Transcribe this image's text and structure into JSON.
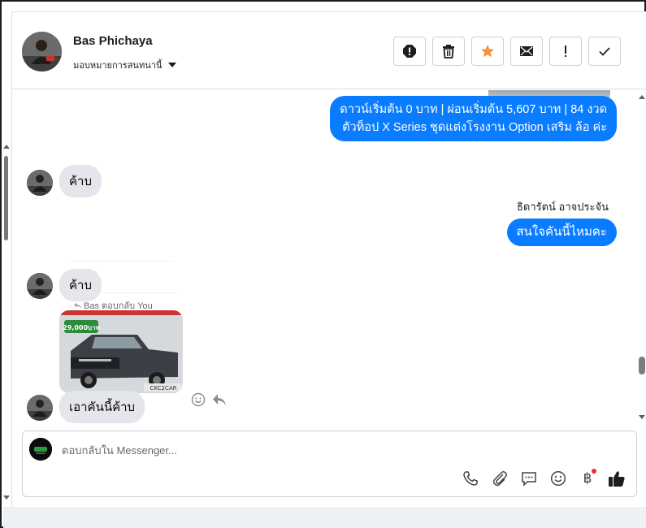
{
  "header": {
    "contact_name": "Bas Phichaya",
    "assign_label": "มอบหมายการสนทนานี้",
    "tools": [
      {
        "name": "spam-button",
        "icon": "stop-alert-icon"
      },
      {
        "name": "delete-button",
        "icon": "trash-icon"
      },
      {
        "name": "star-button",
        "icon": "star-icon"
      },
      {
        "name": "mark-unread-button",
        "icon": "envelope-icon"
      },
      {
        "name": "follow-up-button",
        "icon": "exclamation-icon"
      },
      {
        "name": "mark-done-button",
        "icon": "check-icon"
      }
    ]
  },
  "messages": [
    {
      "type": "outgoing",
      "lines": [
        "ดาวน์เริ่มต้น 0 บาท | ผ่อนเริ่มต้น 5,607 บาท | 84 งวด",
        "ตัวท็อป X Series ชุดแต่งโรงงาน Option เสริม ล้อ ค่ะ"
      ]
    },
    {
      "type": "incoming",
      "text": "ค้าบ"
    },
    {
      "type": "outgoing",
      "sender": "ธิดารัตน์ อาจประจัน",
      "text": "สนใจคันนี้ไหมคะ"
    },
    {
      "type": "incoming",
      "text": "ค้าบ"
    },
    {
      "type": "incoming-reply",
      "reply_note": "Bas ตอบกลับ You",
      "photo_caption": "29,000บาท",
      "photo_plate": "CKC2CAR",
      "text": "เอาคันนี้ค้าบ"
    }
  ],
  "composer": {
    "placeholder": "ตอบกลับใน Messenger...",
    "tools": [
      "phone-icon",
      "paperclip-icon",
      "saved-reply-icon",
      "emoji-icon",
      "baht-icon",
      "like-icon"
    ],
    "baht_symbol": "฿"
  },
  "colors": {
    "outgoing_bubble": "#0a7cff",
    "incoming_bubble": "#e4e6eb",
    "star": "#f7923a",
    "like": "#1c1e21",
    "notification_dot": "#f02849"
  }
}
